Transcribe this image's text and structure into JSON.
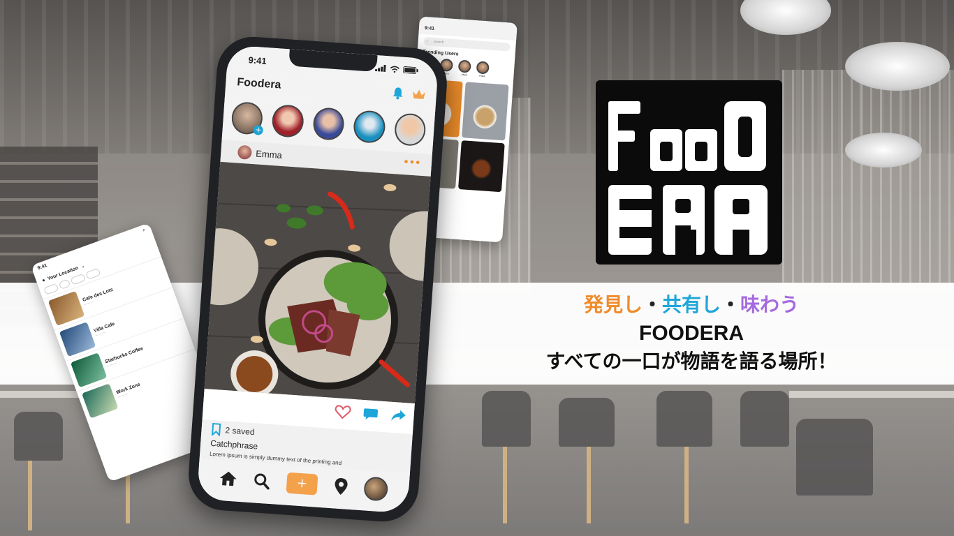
{
  "hero": {
    "tagline": {
      "part1": "発見し",
      "dot1": "・",
      "part2": "共有し",
      "dot2": "・",
      "part3": "味わう"
    },
    "brand": "FOODERA",
    "slogan": "すべての一口が物語を語る場所！",
    "colors": {
      "orange": "#f08b2c",
      "blue": "#1fa6d9",
      "purple": "#a56ae0"
    }
  },
  "logo": {
    "line1": "FOOD",
    "line2": "ERA",
    "background": "#0b0b0b",
    "foreground": "#ffffff"
  },
  "main_phone": {
    "time": "9:41",
    "app_title": "Foodera",
    "header_icons": [
      "bell-icon",
      "crown-icon"
    ],
    "post": {
      "username": "Emma",
      "saved_label": "2 saved",
      "catchphrase": "Catchphrase",
      "caption": "Lorem Ipsum is simply dummy text of the printing and"
    },
    "tabbar": {
      "plus_label": "+"
    }
  },
  "left_screen": {
    "time": "9:41",
    "location_label": "Your Location",
    "cafes": [
      {
        "name": "Cafe des Lots"
      },
      {
        "name": "Villa Cafe"
      },
      {
        "name": "Starbucks Coffee"
      },
      {
        "name": "Work Zone"
      }
    ]
  },
  "right_screen": {
    "time": "9:41",
    "search_placeholder": "search",
    "trending_title": "Trending Users",
    "users": [
      "Jaya",
      "Kata",
      "Jaya",
      "Kata"
    ]
  }
}
